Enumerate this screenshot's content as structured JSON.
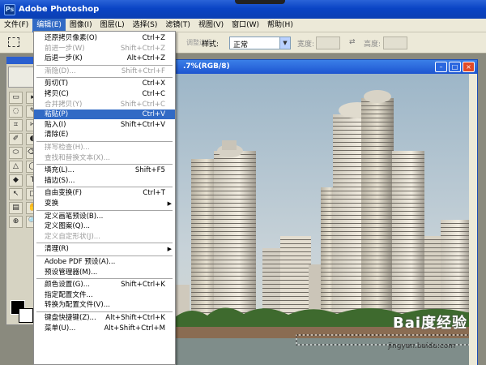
{
  "window": {
    "title": "Adobe Photoshop",
    "logo_text": "Ps"
  },
  "menubar": {
    "items": [
      "文件(F)",
      "编辑(E)",
      "图像(I)",
      "图层(L)",
      "选择(S)",
      "滤镜(T)",
      "视图(V)",
      "窗口(W)",
      "帮助(H)"
    ],
    "active_index": 1
  },
  "options": {
    "style_label": "样式:",
    "style_value": "正常",
    "width_label": "宽度:",
    "height_label": "高度:",
    "swap_symbol": "⇄",
    "faded_text": "调整边缘"
  },
  "document": {
    "title_partial": ".7%(RGB/8)"
  },
  "edit_menu": {
    "items": [
      {
        "label": "还原拷贝像素(O)",
        "shortcut": "Ctrl+Z",
        "state": "normal"
      },
      {
        "label": "前进一步(W)",
        "shortcut": "Shift+Ctrl+Z",
        "state": "disabled"
      },
      {
        "label": "后退一步(K)",
        "shortcut": "Alt+Ctrl+Z",
        "state": "normal"
      },
      {
        "separator": true
      },
      {
        "label": "渐隐(D)...",
        "shortcut": "Shift+Ctrl+F",
        "state": "disabled"
      },
      {
        "separator": true
      },
      {
        "label": "剪切(T)",
        "shortcut": "Ctrl+X",
        "state": "normal"
      },
      {
        "label": "拷贝(C)",
        "shortcut": "Ctrl+C",
        "state": "normal"
      },
      {
        "label": "合并拷贝(Y)",
        "shortcut": "Shift+Ctrl+C",
        "state": "disabled"
      },
      {
        "label": "粘贴(P)",
        "shortcut": "Ctrl+V",
        "state": "highlighted"
      },
      {
        "label": "贴入(I)",
        "shortcut": "Shift+Ctrl+V",
        "state": "normal"
      },
      {
        "label": "清除(E)",
        "shortcut": "",
        "state": "normal"
      },
      {
        "separator": true
      },
      {
        "label": "拼写检查(H)...",
        "shortcut": "",
        "state": "disabled"
      },
      {
        "label": "查找和替换文本(X)...",
        "shortcut": "",
        "state": "disabled"
      },
      {
        "separator": true
      },
      {
        "label": "填充(L)...",
        "shortcut": "Shift+F5",
        "state": "normal"
      },
      {
        "label": "描边(S)...",
        "shortcut": "",
        "state": "normal"
      },
      {
        "separator": true
      },
      {
        "label": "自由变换(F)",
        "shortcut": "Ctrl+T",
        "state": "normal"
      },
      {
        "label": "变换",
        "shortcut": "",
        "state": "normal",
        "submenu": true
      },
      {
        "separator": true
      },
      {
        "label": "定义画笔预设(B)...",
        "shortcut": "",
        "state": "normal"
      },
      {
        "label": "定义图案(Q)...",
        "shortcut": "",
        "state": "normal"
      },
      {
        "label": "定义自定形状(J)...",
        "shortcut": "",
        "state": "disabled"
      },
      {
        "separator": true
      },
      {
        "label": "清理(R)",
        "shortcut": "",
        "state": "normal",
        "submenu": true
      },
      {
        "separator": true
      },
      {
        "label": "Adobe PDF 预设(A)...",
        "shortcut": "",
        "state": "normal"
      },
      {
        "label": "预设管理器(M)...",
        "shortcut": "",
        "state": "normal"
      },
      {
        "separator": true
      },
      {
        "label": "颜色设置(G)...",
        "shortcut": "Shift+Ctrl+K",
        "state": "normal"
      },
      {
        "label": "指定配置文件...",
        "shortcut": "",
        "state": "normal"
      },
      {
        "label": "转换为配置文件(V)...",
        "shortcut": "",
        "state": "normal"
      },
      {
        "separator": true
      },
      {
        "label": "键盘快捷键(Z)...",
        "shortcut": "Alt+Shift+Ctrl+K",
        "state": "normal"
      },
      {
        "label": "菜单(U)...",
        "shortcut": "Alt+Shift+Ctrl+M",
        "state": "normal"
      }
    ]
  },
  "tools": [
    "▭",
    "▸",
    "◌",
    "✎",
    "⌗",
    "✂",
    "✐",
    "◐",
    "⬭",
    "⌫",
    "△",
    "◯",
    "◆",
    "T",
    "↖",
    "□",
    "▤",
    "✋",
    "⊕",
    "🔍"
  ],
  "watermark": {
    "brand": "Bai度经验",
    "url": "jingyan.baidu.com"
  },
  "colors": {
    "highlight": "#316ac5",
    "titlebar": "#0a44c4"
  }
}
